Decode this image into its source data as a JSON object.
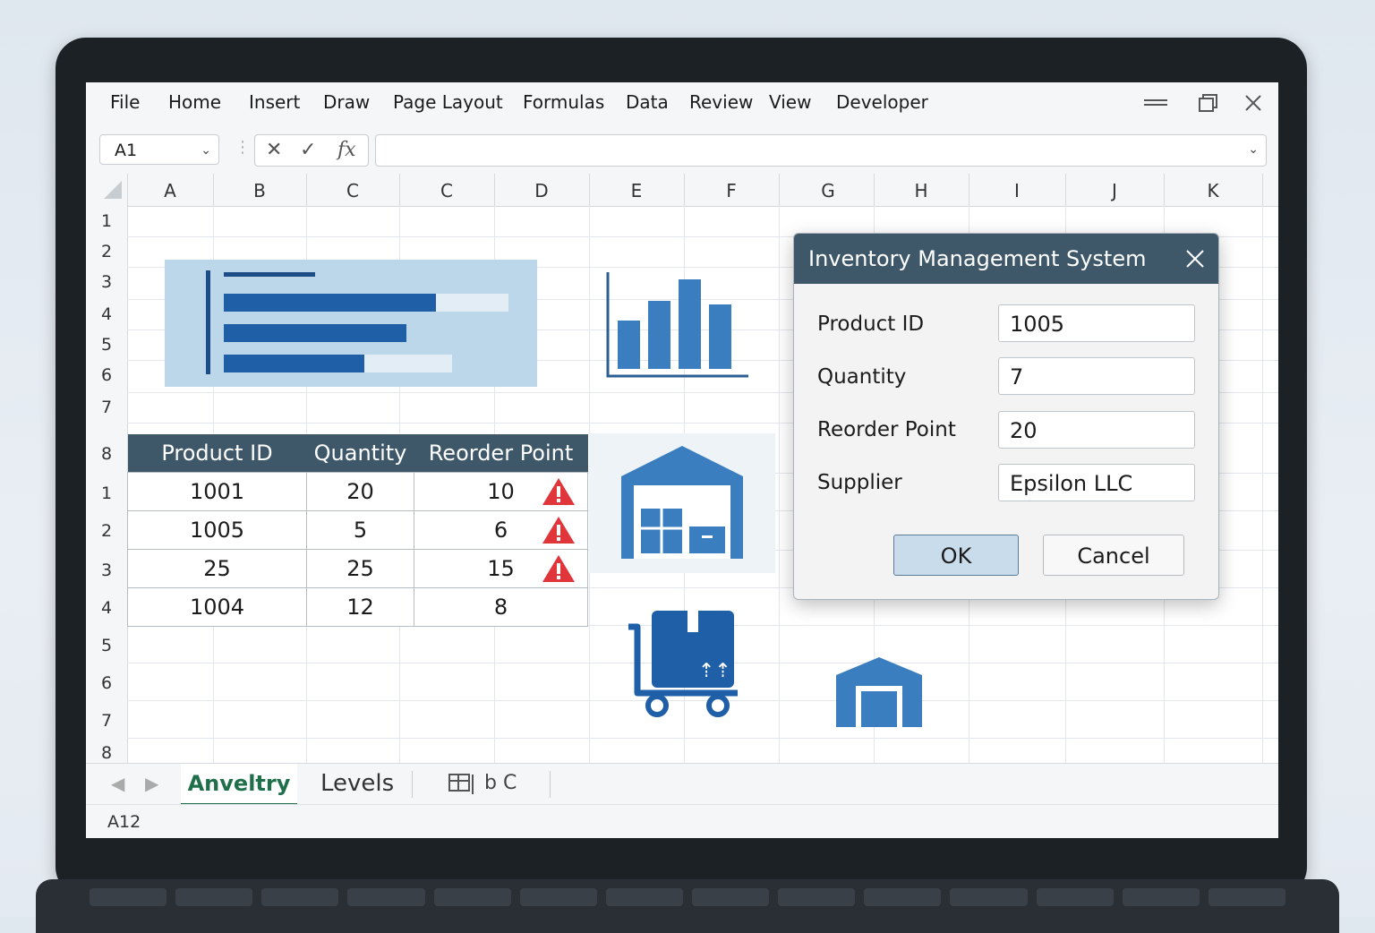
{
  "menu": [
    "File",
    "Home",
    "Insert",
    "Draw",
    "Page Layout",
    "Formulas",
    "Data",
    "Review",
    "View",
    "Developer"
  ],
  "window_controls": {
    "minimize": "minimize-icon",
    "restore": "restore-icon",
    "close": "close-icon"
  },
  "formula_bar": {
    "name_box": "A1",
    "cancel_icon": "✕",
    "enter_icon": "✓",
    "function_icon": "fx",
    "formula": ""
  },
  "columns": [
    "A",
    "B",
    "C",
    "C",
    "D",
    "E",
    "F",
    "G",
    "H",
    "I",
    "J",
    "K"
  ],
  "rows_top": [
    "1",
    "2",
    "3",
    "4",
    "5",
    "6",
    "7",
    "8"
  ],
  "rows_bottom": [
    "1",
    "2",
    "3",
    "4",
    "5",
    "6",
    "7",
    "8"
  ],
  "table": {
    "headers": [
      "Product ID",
      "Quantity",
      "Reorder Point"
    ],
    "rows": [
      {
        "id": "1001",
        "qty": "20",
        "reorder": "10",
        "warn": true
      },
      {
        "id": "1005",
        "qty": "5",
        "reorder": "6",
        "warn": true
      },
      {
        "id": "25",
        "qty": "25",
        "reorder": "15",
        "warn": true
      },
      {
        "id": "1004",
        "qty": "12",
        "reorder": "8",
        "warn": false
      }
    ]
  },
  "dialog": {
    "title": "Inventory Management System",
    "fields": [
      {
        "label": "Product ID",
        "value": "1005"
      },
      {
        "label": "Quantity",
        "value": "7"
      },
      {
        "label": "Reorder Point",
        "value": "20"
      },
      {
        "label": "Supplier",
        "value": "Epsilon LLC"
      }
    ],
    "ok_label": "OK",
    "cancel_label": "Cancel"
  },
  "sheet_tabs": [
    "Anveltry",
    "Levels",
    "b C"
  ],
  "status_cell": "A12",
  "colors": {
    "accent": "#3e5869",
    "icon_blue": "#3a7ebf",
    "warning": "#e0353a",
    "tab_green": "#1f6f4a"
  }
}
